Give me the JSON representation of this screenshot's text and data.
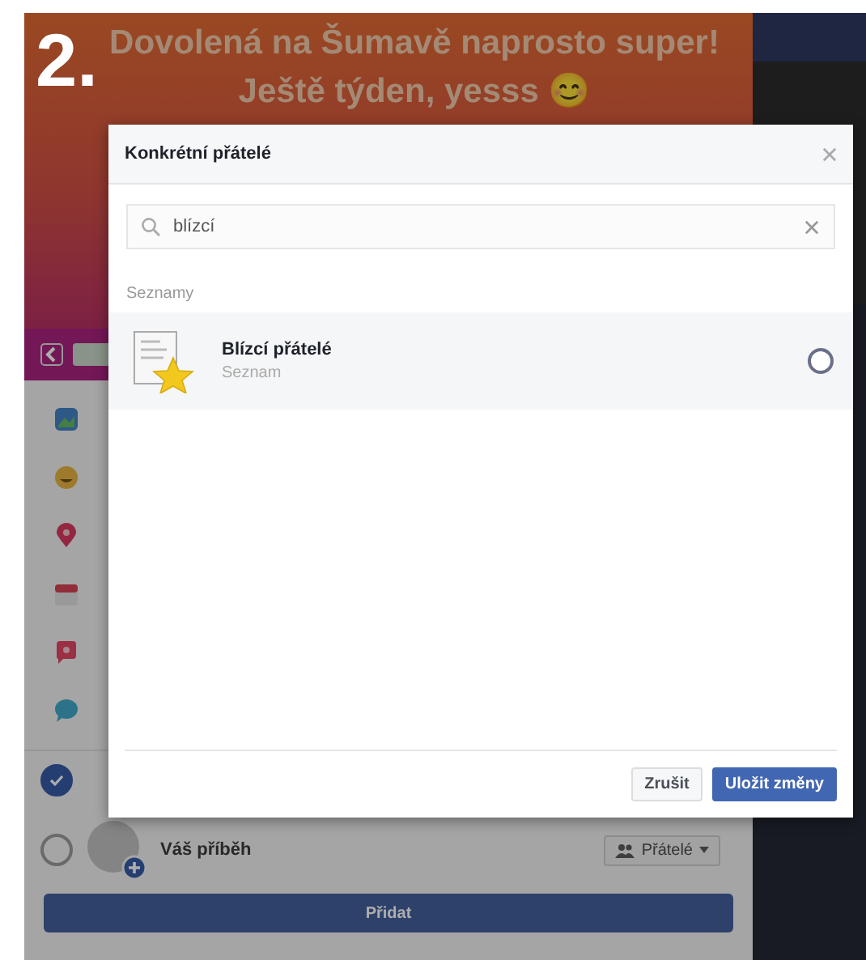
{
  "step_label": "2.",
  "post": {
    "text": "Dovolená na Šumavě naprosto super! Ještě týden, yesss 😊"
  },
  "sidebar_items": [
    {
      "kind": "photo"
    },
    {
      "kind": "feeling"
    },
    {
      "kind": "location"
    },
    {
      "kind": "event"
    },
    {
      "kind": "poll"
    },
    {
      "kind": "chat"
    }
  ],
  "share_option": {
    "checked": true
  },
  "story": {
    "label": "Váš příběh",
    "selected": false,
    "audience": "Přátelé"
  },
  "submit_button": "Přidat",
  "dialog": {
    "title": "Konkrétní přátelé",
    "search": {
      "value": "blízcí"
    },
    "section": "Seznamy",
    "lists": [
      {
        "name": "Blízcí přátelé",
        "type": "Seznam",
        "selected": false
      }
    ],
    "buttons": [
      {
        "label": "Zrušit",
        "kind": "secondary"
      },
      {
        "label": "Uložit změny",
        "kind": "primary"
      }
    ]
  }
}
